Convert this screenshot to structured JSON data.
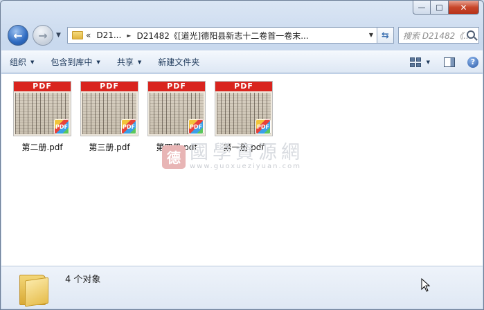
{
  "window": {
    "caption_buttons": {
      "minimize": "—",
      "maximize": "□",
      "close": "✕"
    }
  },
  "nav": {
    "back_glyph": "←",
    "forward_glyph": "→",
    "history_glyph": "▼",
    "address": {
      "overflow": "«",
      "segments": [
        "D21...",
        "D21482《[道光]德阳县新志十二卷首一卷末..."
      ],
      "separator": "►",
      "dropdown": "▼"
    },
    "refresh_glyph": "⇆",
    "search_placeholder": "搜索 D21482《...",
    "search_icon": "search-icon"
  },
  "toolbar": {
    "items": [
      {
        "label": "组织",
        "has_caret": true
      },
      {
        "label": "包含到库中",
        "has_caret": true
      },
      {
        "label": "共享",
        "has_caret": true
      },
      {
        "label": "新建文件夹",
        "has_caret": false
      }
    ],
    "caret": "▼",
    "help": "?"
  },
  "files": [
    {
      "label": "第二册.pdf",
      "band": "PDF",
      "badge": "PDF"
    },
    {
      "label": "第三册.pdf",
      "band": "PDF",
      "badge": "PDF"
    },
    {
      "label": "第四册.pdf",
      "band": "PDF",
      "badge": "PDF"
    },
    {
      "label": "第一册.pdf",
      "band": "PDF",
      "badge": "PDF"
    }
  ],
  "watermark": {
    "seal": "德",
    "title": "國學資源網",
    "url": "www.guoxueziyuan.com"
  },
  "details": {
    "count_text": "4 个对象"
  },
  "colors": {
    "pdf_red": "#d9241e",
    "toolbar_text": "#1e395b",
    "close_red": "#c8472b"
  }
}
